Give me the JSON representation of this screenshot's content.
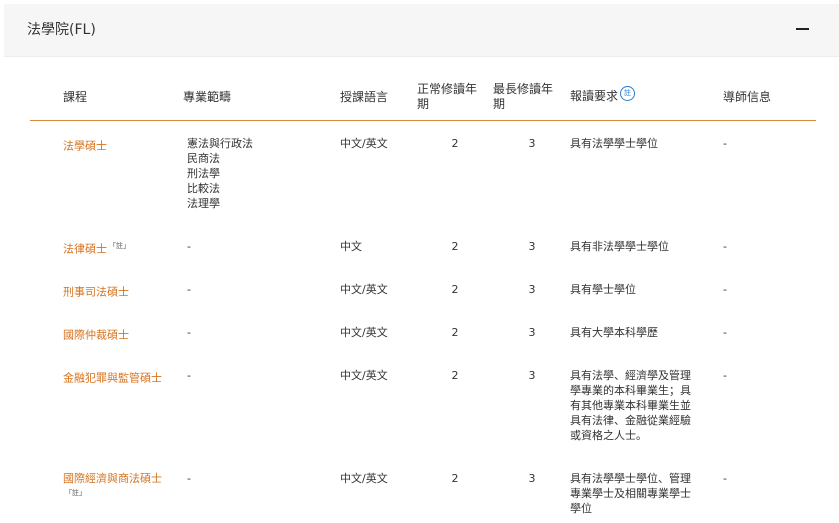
{
  "panel": {
    "title": "法學院(FL)",
    "collapse_glyph": "−"
  },
  "table": {
    "headers": {
      "course": "課程",
      "specialization": "專業範疇",
      "language": "授課語言",
      "normal_years": "正常修讀年期",
      "max_years": "最長修讀年期",
      "requirements": "報讀要求",
      "requirements_note": "註",
      "supervisor": "導師信息"
    },
    "rows": [
      {
        "course": "法學碩士",
        "course_note": "",
        "specializations": [
          "憲法與行政法",
          "民商法",
          "刑法學",
          "比較法",
          "法理學"
        ],
        "language": "中文/英文",
        "normal_years": "2",
        "max_years": "3",
        "requirements": [
          "具有法學學士學位"
        ],
        "supervisor": "-"
      },
      {
        "course": "法律碩士",
        "course_note": "「註」",
        "specializations": [
          "-"
        ],
        "language": "中文",
        "normal_years": "2",
        "max_years": "3",
        "requirements": [
          "具有非法學學士學位"
        ],
        "supervisor": "-"
      },
      {
        "course": "刑事司法碩士",
        "course_note": "",
        "specializations": [
          "-"
        ],
        "language": "中文/英文",
        "normal_years": "2",
        "max_years": "3",
        "requirements": [
          "具有學士學位"
        ],
        "supervisor": "-"
      },
      {
        "course": "國際仲裁碩士",
        "course_note": "",
        "specializations": [
          "-"
        ],
        "language": "中文/英文",
        "normal_years": "2",
        "max_years": "3",
        "requirements": [
          "具有大學本科學歷"
        ],
        "supervisor": "-"
      },
      {
        "course": "金融犯罪與監管碩士",
        "course_note": "",
        "specializations": [
          "-"
        ],
        "language": "中文/英文",
        "normal_years": "2",
        "max_years": "3",
        "requirements": [
          "具有法學、經濟學及管理",
          "學專業的本科畢業生；具",
          "有其他專業本科畢業生並",
          "具有法律、金融從業經驗",
          "或資格之人士。"
        ],
        "supervisor": "-"
      },
      {
        "course": "國際經濟與商法碩士",
        "course_note": "「註」",
        "specializations": [
          "-"
        ],
        "language": "中文/英文",
        "normal_years": "2",
        "max_years": "3",
        "requirements": [
          "具有法學學士學位、管理",
          "專業學士及相關專業學士",
          "學位"
        ],
        "supervisor": "-"
      }
    ]
  }
}
